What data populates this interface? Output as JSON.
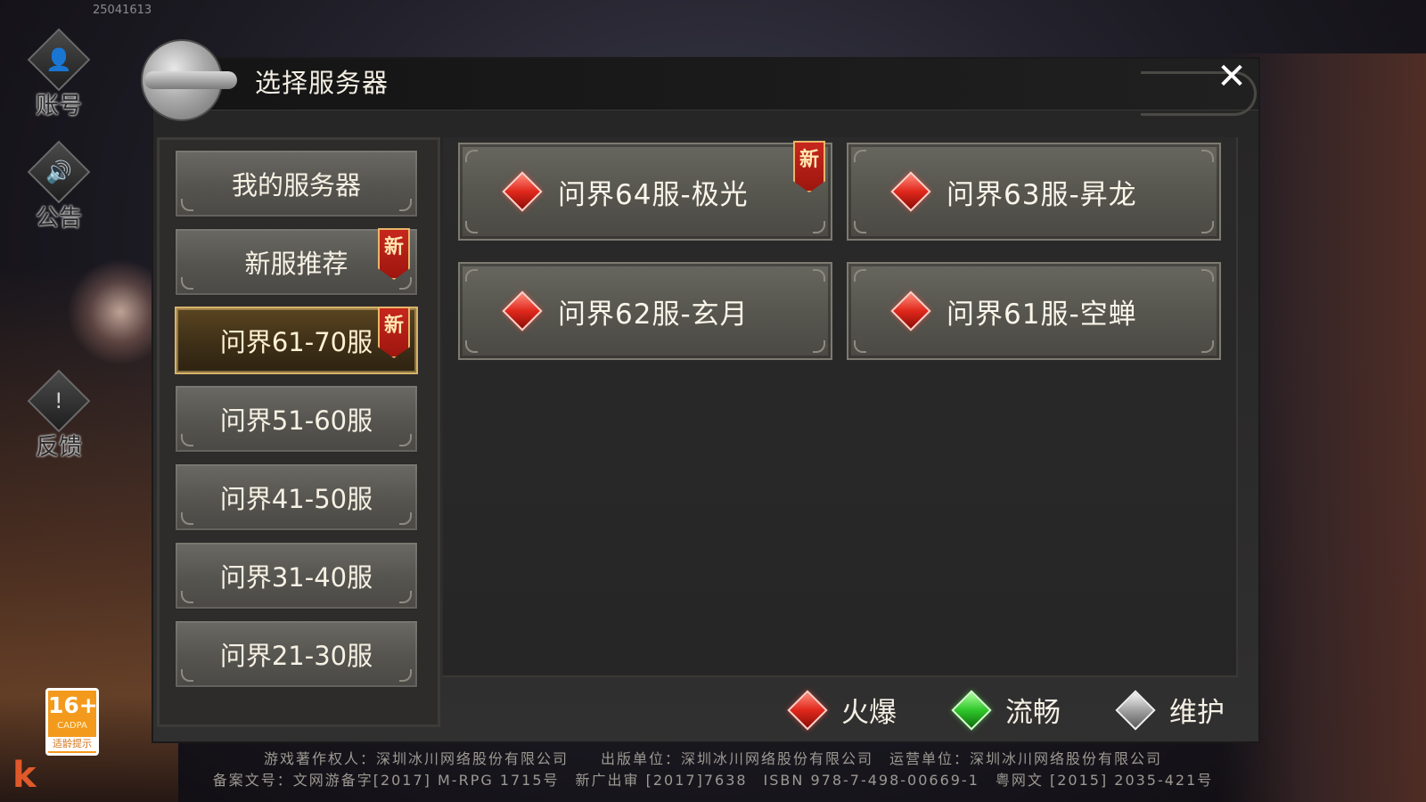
{
  "build_id": "25041613",
  "side": {
    "account_label": "账号",
    "notice_label": "公告",
    "feedback_label": "反馈"
  },
  "age_badge": {
    "age": "16+",
    "org": "CADPA",
    "tip": "适龄提示"
  },
  "logo_letter": "k",
  "dialog": {
    "title": "选择服务器",
    "close_symbol": "✕"
  },
  "categories": [
    {
      "label": "我的服务器",
      "new": false,
      "active": false
    },
    {
      "label": "新服推荐",
      "new": true,
      "active": false
    },
    {
      "label": "问界61-70服",
      "new": true,
      "active": true
    },
    {
      "label": "问界51-60服",
      "new": false,
      "active": false
    },
    {
      "label": "问界41-50服",
      "new": false,
      "active": false
    },
    {
      "label": "问界31-40服",
      "new": false,
      "active": false
    },
    {
      "label": "问界21-30服",
      "new": false,
      "active": false
    }
  ],
  "new_tag": "新",
  "servers": [
    {
      "name": "问界64服-极光",
      "status": "火爆",
      "new": true
    },
    {
      "name": "问界63服-昇龙",
      "status": "火爆",
      "new": false
    },
    {
      "name": "问界62服-玄月",
      "status": "火爆",
      "new": false
    },
    {
      "name": "问界61服-空蝉",
      "status": "火爆",
      "new": false
    }
  ],
  "legend": {
    "hot": "火爆",
    "smooth": "流畅",
    "maintenance": "维护"
  },
  "colors": {
    "hot": "#e0281c",
    "smooth": "#2fc72a",
    "maintenance": "#a2a2a2",
    "active_border": "#d7b269"
  },
  "footer": {
    "line1": "游戏著作权人：深圳冰川网络股份有限公司　　出版单位：深圳冰川网络股份有限公司　运营单位：深圳冰川网络股份有限公司",
    "line2": "备案文号：文网游备字[2017] M-RPG 1715号　新广出审 [2017]7638　ISBN 978-7-498-00669-1　粤网文 [2015] 2035-421号"
  }
}
